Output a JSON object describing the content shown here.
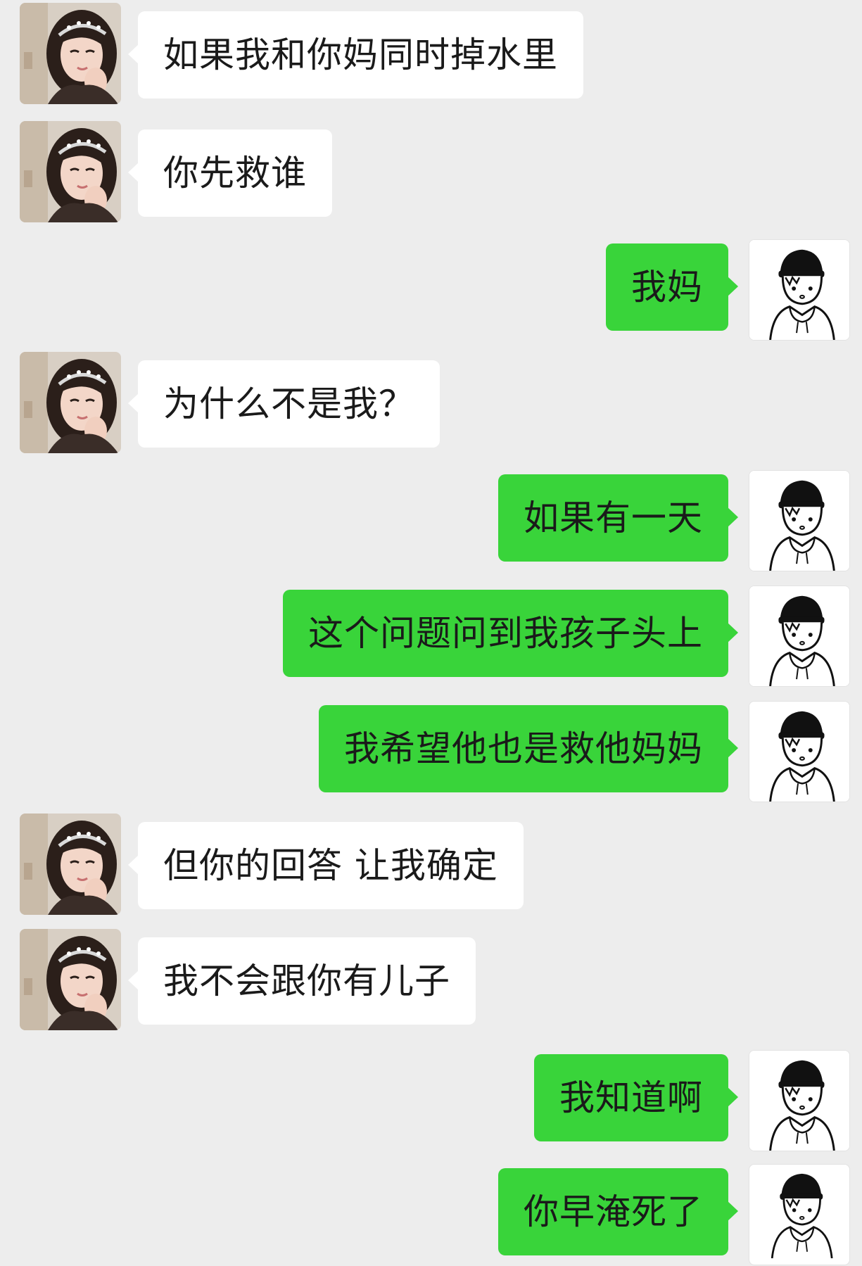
{
  "conversation": {
    "messages": [
      {
        "sender": "her",
        "text": "如果我和你妈同时掉水里"
      },
      {
        "sender": "her",
        "text": "你先救谁"
      },
      {
        "sender": "me",
        "text": "我妈"
      },
      {
        "sender": "her",
        "text": "为什么不是我？"
      },
      {
        "sender": "me",
        "text": "如果有一天"
      },
      {
        "sender": "me",
        "text": "这个问题问到我孩子头上"
      },
      {
        "sender": "me",
        "text": "我希望他也是救他妈妈"
      },
      {
        "sender": "her",
        "text": "但你的回答 让我确定"
      },
      {
        "sender": "her",
        "text": "我不会跟你有儿子"
      },
      {
        "sender": "me",
        "text": "我知道啊"
      },
      {
        "sender": "me",
        "text": "你早淹死了"
      }
    ]
  },
  "colors": {
    "background": "#ededed",
    "incoming_bubble": "#ffffff",
    "outgoing_bubble": "#39d43a",
    "text": "#1a1a1a"
  },
  "icons": {
    "her_avatar": "girl-photo-avatar",
    "my_avatar": "line-art-boy-avatar"
  }
}
